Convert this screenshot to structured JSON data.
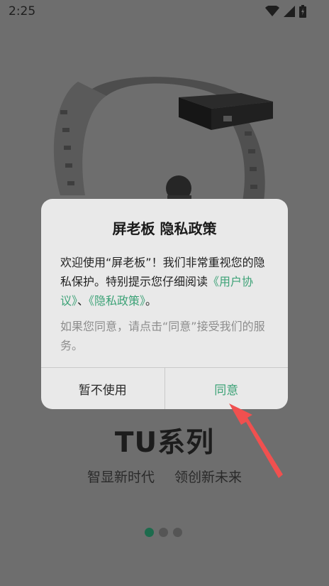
{
  "status_bar": {
    "time": "2:25",
    "icons": [
      "wifi-icon",
      "signal-icon",
      "battery-icon"
    ]
  },
  "onboarding": {
    "headline": "TU系列",
    "tagline_parts": [
      "智显新时代",
      "领创新未来"
    ],
    "pager": {
      "total": 3,
      "active_index": 0
    }
  },
  "dialog": {
    "title": "屏老板 隐私政策",
    "body_text_1": "欢迎使用“屏老板”！我们非常重视您的隐私保护。特别提示您仔细阅读",
    "link_user_agreement": "《用户协议》",
    "separator": "、",
    "link_privacy_policy": "《隐私政策》",
    "body_end": "。",
    "note": "如果您同意，请点击“同意”接受我们的服务。",
    "decline_label": "暂不使用",
    "agree_label": "同意"
  },
  "colors": {
    "accent": "#3da277",
    "arrow": "#f0504f",
    "pager_active": "#1d6b4d"
  }
}
